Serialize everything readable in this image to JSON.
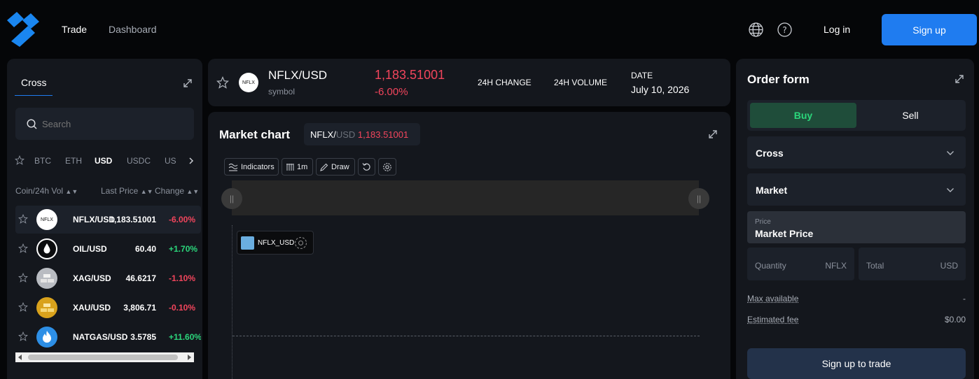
{
  "nav": {
    "trade": "Trade",
    "dashboard": "Dashboard",
    "login": "Log in",
    "signup": "Sign up"
  },
  "left": {
    "tab": "Cross",
    "search_placeholder": "Search",
    "filters": [
      "BTC",
      "ETH",
      "USD",
      "USDC",
      "US"
    ],
    "active_filter": "USD",
    "col_coin": "Coin/24h Vol",
    "col_price": "Last Price",
    "col_change": "Change",
    "rows": [
      {
        "name": "NFLX/USD",
        "price": "1,183.51001",
        "change": "-6.00%",
        "dir": "neg",
        "logo": "NFLX"
      },
      {
        "name": "OIL/USD",
        "price": "60.40",
        "change": "+1.70%",
        "dir": "pos"
      },
      {
        "name": "XAG/USD",
        "price": "46.6217",
        "change": "-1.10%",
        "dir": "neg"
      },
      {
        "name": "XAU/USD",
        "price": "3,806.71",
        "change": "-0.10%",
        "dir": "neg"
      },
      {
        "name": "NATGAS/USD",
        "price": "3.5785",
        "change": "+11.60%",
        "dir": "pos"
      }
    ]
  },
  "ticker": {
    "logo": "NFLX",
    "symbol": "NFLX/USD",
    "subtitle": "symbol",
    "price": "1,183.51001",
    "change": "-6.00%",
    "change24_label": "24H CHANGE",
    "volume24_label": "24H VOLUME",
    "date_label": "DATE",
    "date": "July 10, 2026"
  },
  "chart": {
    "title": "Market chart",
    "pair_base": "NFLX/",
    "pair_quote": "USD",
    "pair_price": "1,183.51001",
    "indicators": "Indicators",
    "interval": "1m",
    "draw": "Draw",
    "legend": "NFLX_USD",
    "legend_color": "#6aaee0"
  },
  "order": {
    "title": "Order form",
    "buy": "Buy",
    "sell": "Sell",
    "margin": "Cross",
    "type": "Market",
    "price_label": "Price",
    "price_value": "Market Price",
    "quantity_label": "Quantity",
    "quantity_unit": "NFLX",
    "total_label": "Total",
    "total_unit": "USD",
    "max_label": "Max available",
    "max_value": "-",
    "fee_label": "Estimated fee",
    "fee_value": "$0.00",
    "cta": "Sign up to trade"
  },
  "colors": {
    "accent": "#1f7cf0",
    "buy": "#2bd67b",
    "sell": "#f2455c"
  }
}
